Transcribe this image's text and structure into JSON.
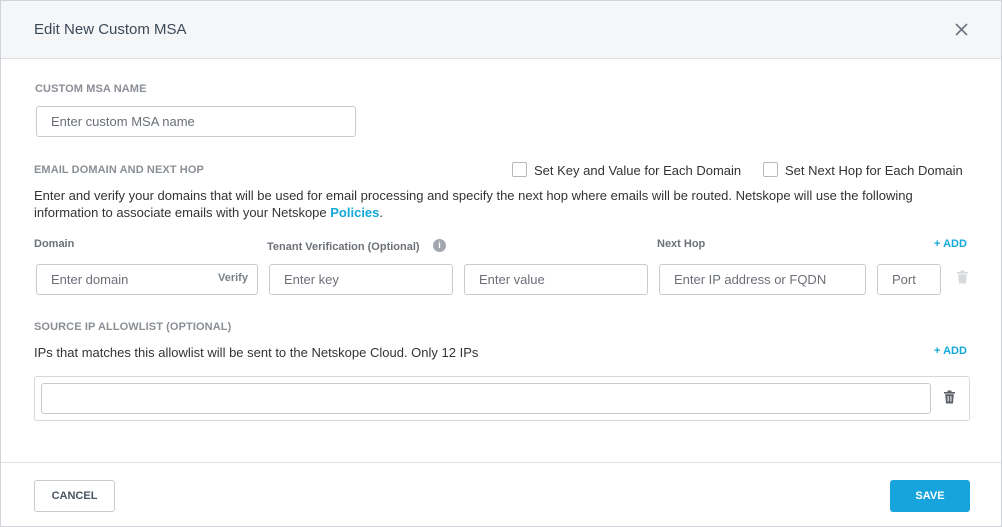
{
  "dialog": {
    "title": "Edit New Custom MSA"
  },
  "msa_name": {
    "label": "CUSTOM MSA NAME",
    "placeholder": "Enter custom MSA name",
    "value": ""
  },
  "email_domain": {
    "label": "EMAIL DOMAIN AND NEXT HOP",
    "checkbox_key_value": {
      "label": "Set Key and Value for Each Domain",
      "checked": false
    },
    "checkbox_next_hop": {
      "label": "Set Next Hop for Each Domain",
      "checked": false
    },
    "description_text": "Enter and verify your domains that will be used for email processing and specify the next hop where emails will be routed. Netskope will use the following information to associate emails with your Netskope ",
    "description_link": "Policies",
    "description_end": ".",
    "columns": {
      "domain": "Domain",
      "tenant_verification": "Tenant Verification (Optional)",
      "next_hop": "Next Hop"
    },
    "add_label": "+ ADD",
    "row": {
      "domain_placeholder": "Enter domain",
      "verify_label": "Verify",
      "key_placeholder": "Enter key",
      "value_placeholder": "Enter value",
      "next_hop_placeholder": "Enter IP address or FQDN",
      "port_placeholder": "Port"
    }
  },
  "source_ip": {
    "label": "SOURCE IP ALLOWLIST (OPTIONAL)",
    "description": "IPs that matches this allowlist will be sent to the Netskope Cloud. Only 12 IPs",
    "add_label": "+ ADD",
    "value": ""
  },
  "footer": {
    "cancel_label": "CANCEL",
    "save_label": "SAVE"
  },
  "colors": {
    "accent": "#17a4dc",
    "link": "#12a8d8"
  }
}
